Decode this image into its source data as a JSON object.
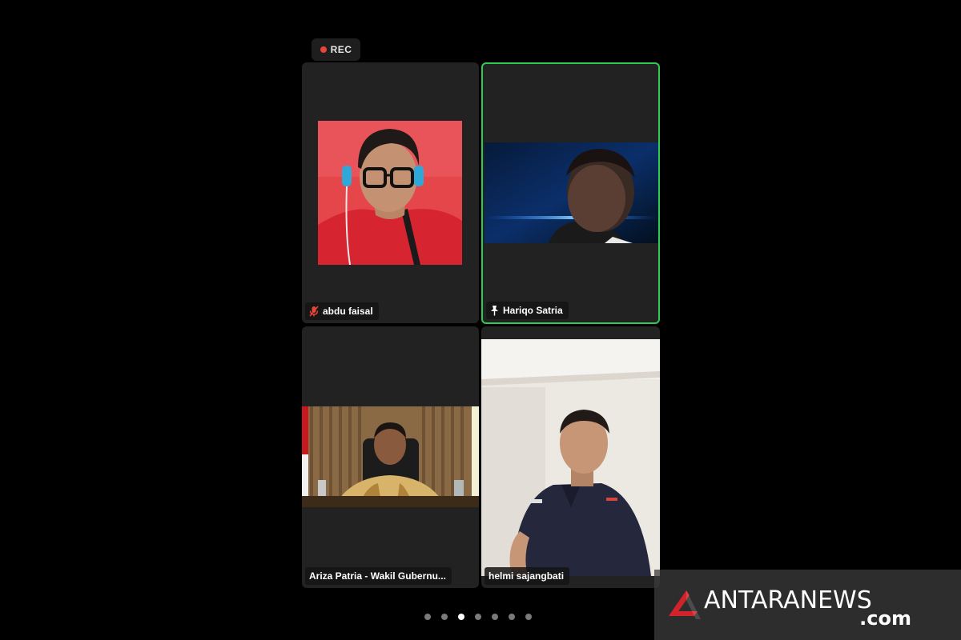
{
  "recording": {
    "label": "REC",
    "dot_color": "#e8443a"
  },
  "participants": [
    {
      "name": "abdu faisal",
      "status_icon": "mic-muted-icon",
      "active_speaker": false
    },
    {
      "name": "Hariqo Satria",
      "status_icon": "pin-icon",
      "active_speaker": true
    },
    {
      "name": "Ariza Patria - Wakil Gubernu...",
      "status_icon": "",
      "active_speaker": false
    },
    {
      "name": "helmi sajangbati",
      "status_icon": "",
      "active_speaker": false
    }
  ],
  "pagination": {
    "total_pages": 7,
    "current_page": 3
  },
  "watermark": {
    "brand": "ANTARANEWS",
    "suffix": ".com",
    "logo_icon": "antara-logo-icon"
  },
  "colors": {
    "active_border": "#2ecc4f",
    "tile_bg": "#222222",
    "background": "#000000"
  }
}
